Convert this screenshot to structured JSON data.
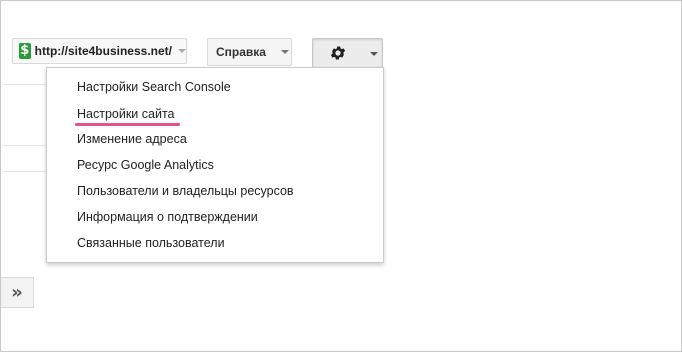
{
  "site_selector": {
    "icon": "dollar-icon",
    "url": "http://site4business.net/"
  },
  "help_menu": {
    "label": "Справка"
  },
  "settings_button": {
    "icon": "gear-icon",
    "caret": "chevron-down-icon"
  },
  "settings_menu": {
    "items": [
      {
        "label": "Настройки Search Console"
      },
      {
        "label": "Настройки сайта",
        "highlighted": true
      },
      {
        "label": "Изменение адреса"
      },
      {
        "label": "Ресурс Google Analytics"
      },
      {
        "label": "Пользователи и владельцы ресурсов"
      },
      {
        "label": "Информация о подтверждении"
      },
      {
        "label": "Связанные пользователи"
      }
    ]
  },
  "sidebar_toggle": {
    "icon": "double-chevron-right-icon",
    "glyph": "»"
  },
  "colors": {
    "highlight_underline": "#e5528a",
    "site_icon": "#2a9a3b"
  }
}
